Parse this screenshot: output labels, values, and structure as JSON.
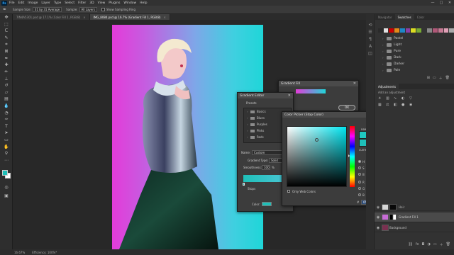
{
  "app": {
    "logo": "Ps",
    "menu": [
      "File",
      "Edit",
      "Image",
      "Layer",
      "Type",
      "Select",
      "Filter",
      "3D",
      "View",
      "Plugins",
      "Window",
      "Help"
    ],
    "window_controls": [
      "—",
      "□",
      "✕"
    ]
  },
  "options_bar": {
    "tool_icon": "eyedropper-icon",
    "sample_size_label": "Sample Size:",
    "sample_size_value": "31 by 31 Average",
    "sample_label": "Sample:",
    "sample_value": "All Layers",
    "show_ring_label": "Show Sampling Ring"
  },
  "doc_tabs": [
    {
      "label": "7IN4A5301.psd @ 17.1% (Color Fill 1, RGB/8)",
      "close": "✕",
      "active": false
    },
    {
      "label": "IMG_8084.psd @ 16.7% (Gradient Fill 1, RGB/8)",
      "close": "✕",
      "active": true
    }
  ],
  "status_bar": {
    "zoom": "16.67%",
    "doc_info": "Efficiency: 100%*"
  },
  "right_panel": {
    "top_tabs": [
      "Navigator",
      "Swatches",
      "Color"
    ],
    "active_tab": "Swatches",
    "swatch_rows": [
      [
        "#2a2a2a",
        "#e0e0e0",
        "#cc0000",
        "#e48b1a",
        "#1e88c8",
        "#8a3fa6",
        "#dddd22",
        "#77aa33",
        "#333333",
        "#888888",
        "#b05878",
        "#c67a94",
        "#e0a0b6",
        "#aaaaaa"
      ]
    ],
    "swatch_folders": [
      "Pastel",
      "Light",
      "Pure",
      "Dark",
      "Darker",
      "Pale"
    ],
    "bottom_icons": [
      "⊞",
      "▭",
      "＋",
      "🗑"
    ],
    "adjustments_tabs": [
      "Adjustments"
    ],
    "adjust_hint": "Add an adjustment",
    "layers": [
      {
        "name": "Gradient Fill 1",
        "thumb": "#c86cd6"
      },
      {
        "name": "Background",
        "thumb": "#7a3050"
      }
    ],
    "layer_unnamed_label": "Hair"
  },
  "gradient_fill": {
    "title": "Gradient Fill",
    "ok_label": "OK",
    "close": "✕"
  },
  "gradient_editor": {
    "title": "Gradient Editor",
    "presets_label": "Presets",
    "presets": [
      "Basics",
      "Blues",
      "Purples",
      "Pinks",
      "Reds"
    ],
    "name_label": "Name:",
    "name_value": "Custom",
    "type_label": "Gradient Type:",
    "type_value": "Solid",
    "smooth_label": "Smoothness:",
    "smooth_value": "100",
    "smooth_unit": "%",
    "stops_label": "Stops",
    "color_label": "Color:",
    "stop_color": "#1fbfb8",
    "ok_label": "OK",
    "close": "✕"
  },
  "color_picker": {
    "title": "Color Picker (Stop Color)",
    "close": "✕",
    "new_label": "new",
    "current_label": "current",
    "new_color": "#1fc8c0",
    "current_color": "#1fbfb8",
    "ok_label": "OK",
    "cancel_label": "Cancel",
    "add_swatch_label": "Add to Swatches",
    "libraries_label": "Color Libraries",
    "only_web_label": "Only Web Colors",
    "fields_left": [
      {
        "name": "H",
        "value": "184",
        "unit": "°",
        "on": true
      },
      {
        "name": "S",
        "value": "84",
        "unit": "%",
        "on": false
      },
      {
        "name": "B",
        "value": "81",
        "unit": "%",
        "on": false
      },
      {
        "name": "R",
        "value": "111",
        "unit": "",
        "on": false
      },
      {
        "name": "G",
        "value": "198",
        "unit": "",
        "on": false
      },
      {
        "name": "B",
        "value": "206",
        "unit": "",
        "on": false
      }
    ],
    "fields_right": [
      {
        "name": "L",
        "value": "73",
        "unit": ""
      },
      {
        "name": "a",
        "value": "-41",
        "unit": ""
      },
      {
        "name": "b",
        "value": "-15",
        "unit": ""
      },
      {
        "name": "C",
        "value": "42",
        "unit": "%"
      },
      {
        "name": "M",
        "value": "0",
        "unit": "%"
      },
      {
        "name": "Y",
        "value": "15",
        "unit": "%"
      },
      {
        "name": "K",
        "value": "0",
        "unit": "%"
      }
    ],
    "hex_label": "#",
    "hex_value": "6fc6ce"
  }
}
